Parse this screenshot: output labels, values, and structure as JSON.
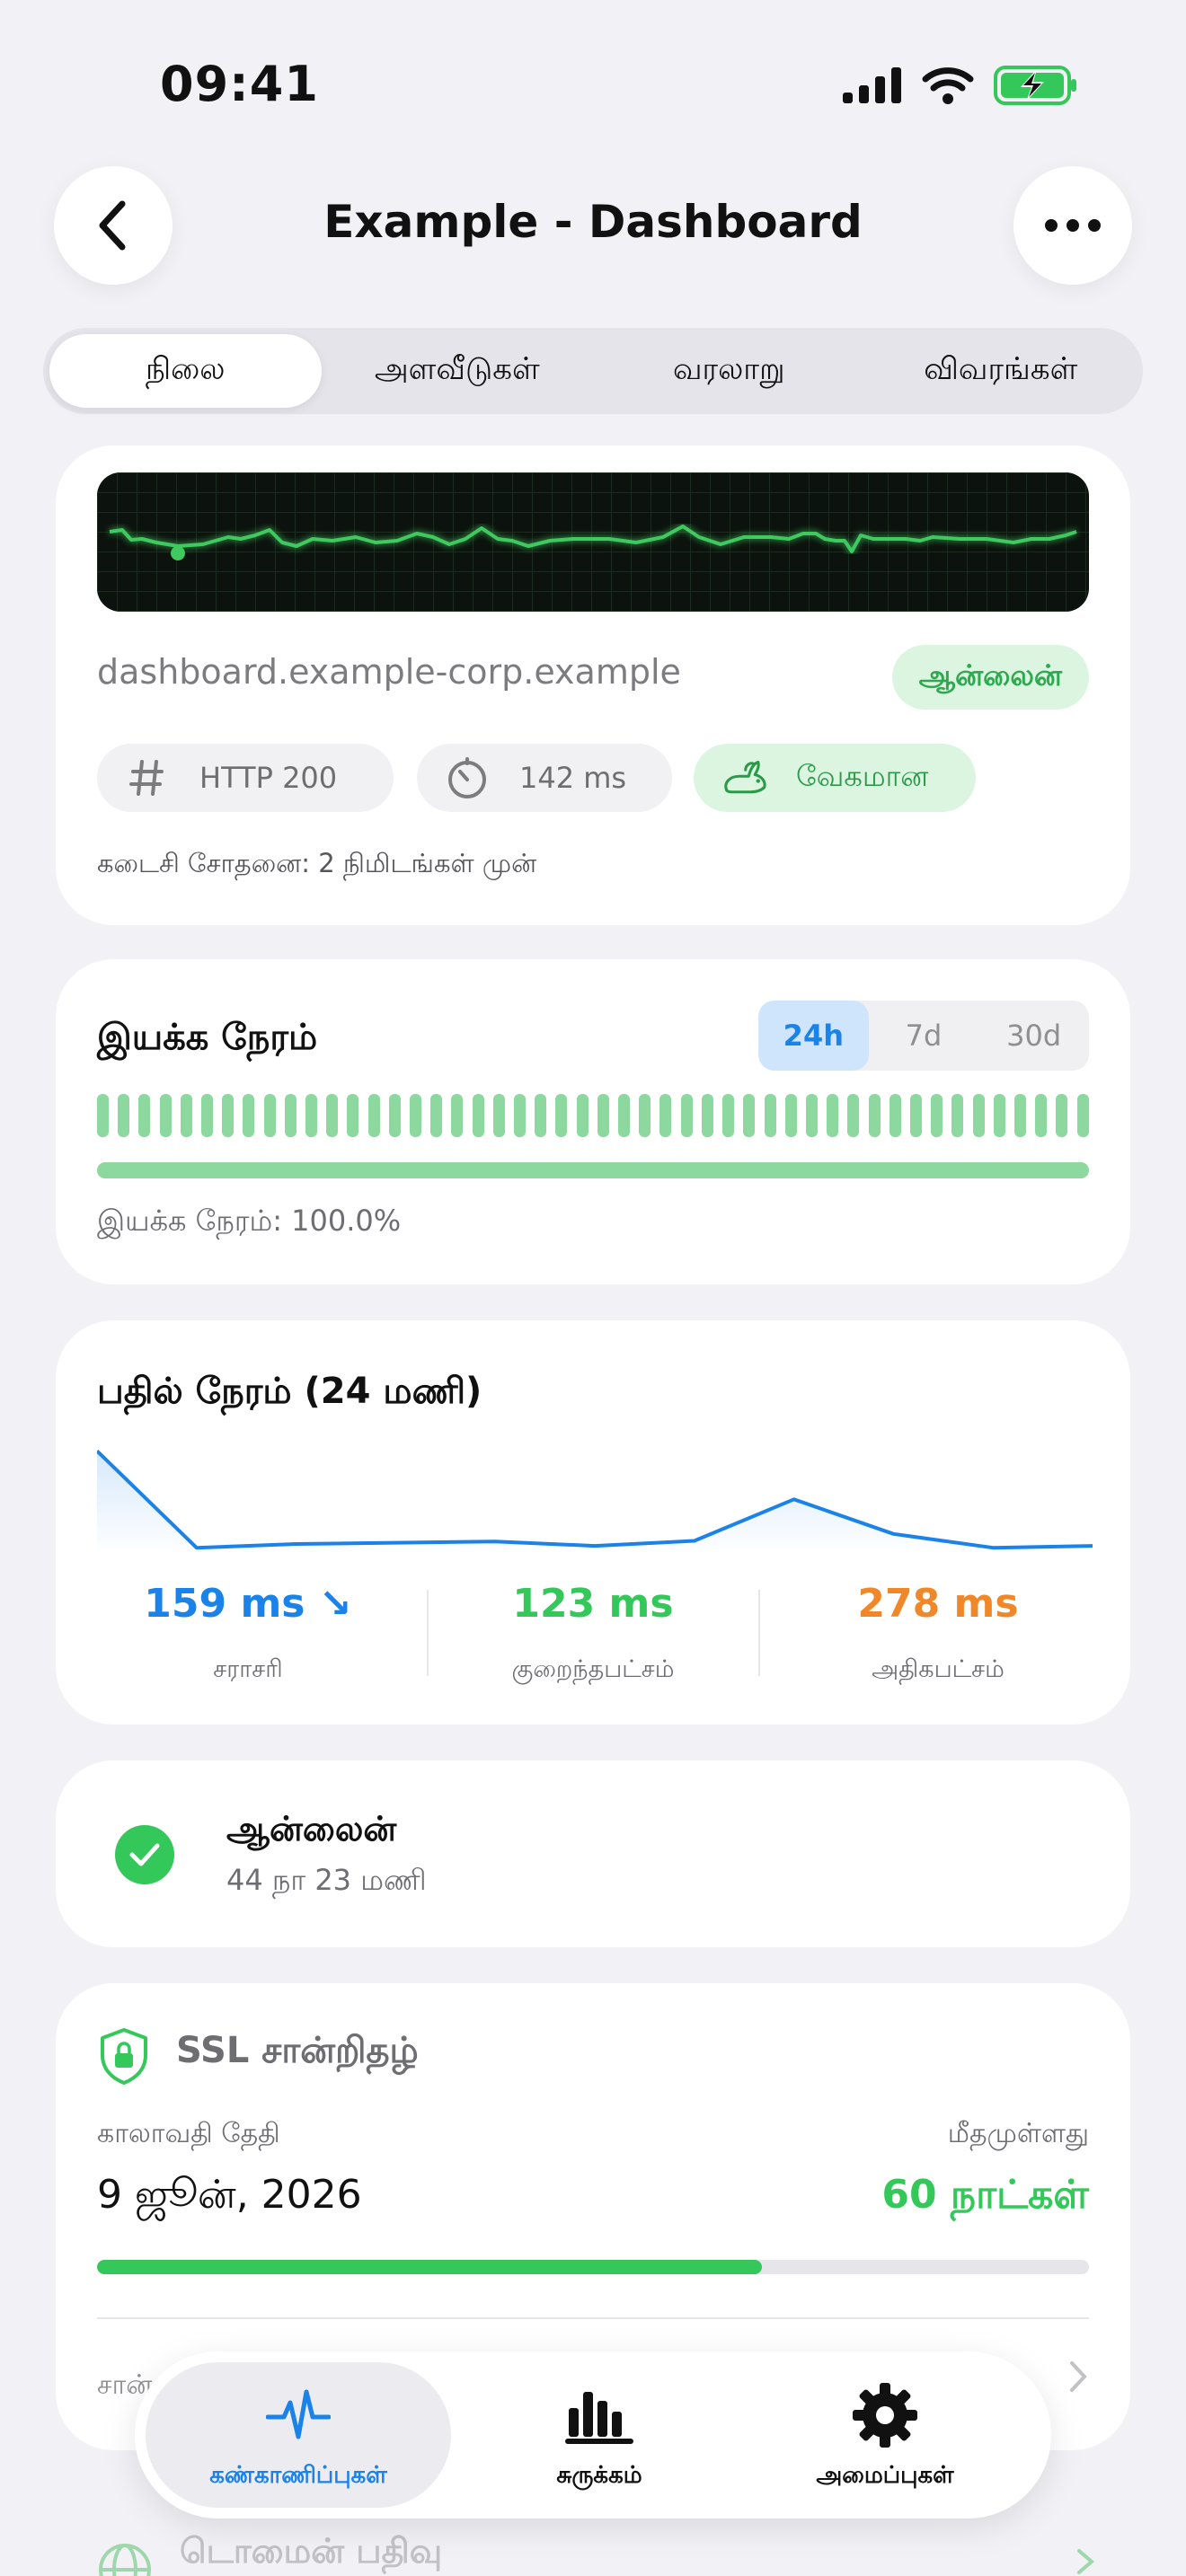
{
  "status_bar": {
    "time": "09:41"
  },
  "header": {
    "title": "Example - Dashboard"
  },
  "tabs": [
    {
      "label": "நிலை",
      "active": true
    },
    {
      "label": "அளவீடுகள்",
      "active": false
    },
    {
      "label": "வரலாறு",
      "active": false
    },
    {
      "label": "விவரங்கள்",
      "active": false
    }
  ],
  "monitor": {
    "domain": "dashboard.example-corp.example",
    "status_badge": "ஆன்லைன்",
    "pills": [
      {
        "icon": "hash-icon",
        "text": "HTTP 200"
      },
      {
        "icon": "timer-icon",
        "text": "142 ms"
      },
      {
        "icon": "rabbit-icon",
        "text": "வேகமான"
      }
    ],
    "last_check": "கடைசி சோதனை: 2 நிமிடங்கள் முன்"
  },
  "uptime": {
    "title": "இயக்க நேரம்",
    "ranges": [
      "24h",
      "7d",
      "30d"
    ],
    "selected_range": "24h",
    "value_percent": 100.0,
    "text": "இயக்க நேரம்: 100.0%"
  },
  "response": {
    "title": "பதில் நேரம் (24 மணி)",
    "stats": [
      {
        "value": "159 ms ↘",
        "label": "சராசரி",
        "color": "#1a82e8"
      },
      {
        "value": "123 ms",
        "label": "குறைந்தபட்சம்",
        "color": "#34c759"
      },
      {
        "value": "278 ms",
        "label": "அதிகபட்சம்",
        "color": "#f0882a"
      }
    ]
  },
  "chart_data": {
    "type": "line",
    "title": "பதில் நேரம் (24 மணி)",
    "series": [
      {
        "values": [
          278,
          124,
          130,
          132,
          134,
          127,
          135,
          201,
          146,
          124,
          127
        ]
      }
    ],
    "ylim": [
      120,
      280
    ],
    "grid": false,
    "color": "#1a82e8"
  },
  "current_status": {
    "title": "ஆன்லைன்",
    "duration": "44 நா 23 மணி"
  },
  "ssl": {
    "title": "SSL சான்றிதழ்",
    "expiry_label": "காலாவதி தேதி",
    "expiry_date": "9 ஜூன், 2026",
    "remaining_label": "மீதமுள்ளது",
    "remaining_value": "60 நாட்கள்",
    "remaining_fraction": 0.67,
    "issuer_label": "சான்"
  },
  "domain_section": {
    "title": "டொமைன் பதிவு"
  },
  "tabbar": [
    {
      "label": "கண்காணிப்புகள்",
      "icon": "pulse-icon",
      "active": true
    },
    {
      "label": "சுருக்கம்",
      "icon": "bar-chart-icon",
      "active": false
    },
    {
      "label": "அமைப்புகள்",
      "icon": "gear-icon",
      "active": false
    }
  ],
  "colors": {
    "accent": "#1a82e8",
    "success": "#34c759",
    "warning": "#f0882a",
    "background": "#f1f1f6"
  }
}
